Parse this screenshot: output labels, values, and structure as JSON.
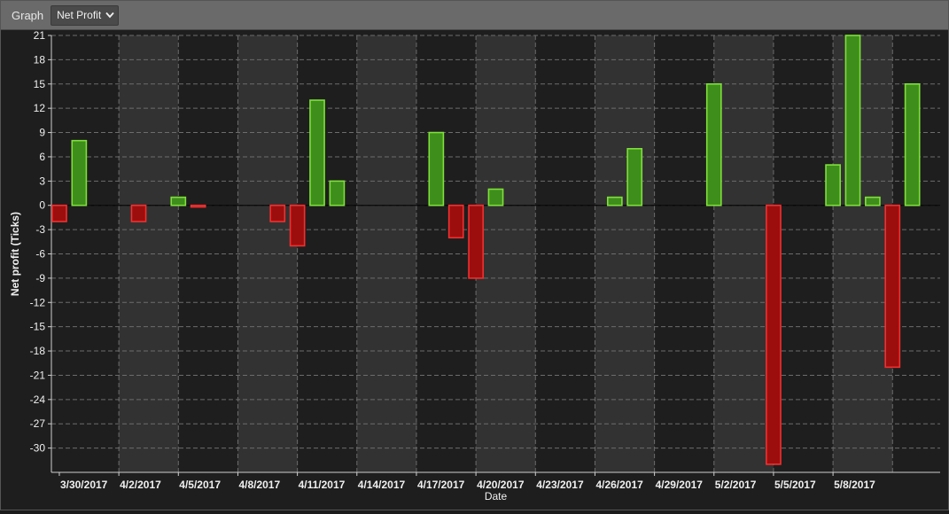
{
  "toolbar": {
    "label": "Graph",
    "selected": "Net Profit"
  },
  "colors": {
    "positive_fill": "#3e8e1c",
    "positive_stroke": "#7fe03a",
    "negative_fill": "#9c0e0e",
    "negative_stroke": "#f03030",
    "band": "#323232",
    "background": "#1e1e1e"
  },
  "chart_data": {
    "type": "bar",
    "xlabel": "Date",
    "ylabel": "Net profit (Ticks)",
    "ylim": [
      -33,
      21
    ],
    "ytick_step": 3,
    "ytick_start": -30,
    "grid": true,
    "x_tick_labels": [
      "3/30/2017",
      "4/2/2017",
      "4/5/2017",
      "4/8/2017",
      "4/11/2017",
      "4/14/2017",
      "4/17/2017",
      "4/20/2017",
      "4/23/2017",
      "4/26/2017",
      "4/29/2017",
      "5/2/2017",
      "5/5/2017",
      "5/8/2017"
    ],
    "x_range_days": [
      -0.4,
      44.4
    ],
    "days_per_tick": 3,
    "bars": [
      {
        "date": "3/30/2017",
        "value": -2
      },
      {
        "date": "3/31/2017",
        "value": 8
      },
      {
        "date": "4/3/2017",
        "value": -2
      },
      {
        "date": "4/5/2017",
        "value": 1
      },
      {
        "date": "4/6/2017",
        "value": -0.2
      },
      {
        "date": "4/10/2017",
        "value": -2
      },
      {
        "date": "4/11/2017",
        "value": -5
      },
      {
        "date": "4/12/2017",
        "value": 13
      },
      {
        "date": "4/13/2017",
        "value": 3
      },
      {
        "date": "4/18/2017",
        "value": 9
      },
      {
        "date": "4/19/2017",
        "value": -4
      },
      {
        "date": "4/20/2017",
        "value": -9
      },
      {
        "date": "4/21/2017",
        "value": 2
      },
      {
        "date": "4/27/2017",
        "value": 1
      },
      {
        "date": "4/28/2017",
        "value": 7
      },
      {
        "date": "5/2/2017",
        "value": 15
      },
      {
        "date": "5/5/2017",
        "value": -32
      },
      {
        "date": "5/8/2017",
        "value": 5
      },
      {
        "date": "5/9/2017",
        "value": 21
      },
      {
        "date": "5/10/2017",
        "value": 1
      },
      {
        "date": "5/11/2017",
        "value": -20
      },
      {
        "date": "5/12/2017",
        "value": 15
      }
    ]
  }
}
